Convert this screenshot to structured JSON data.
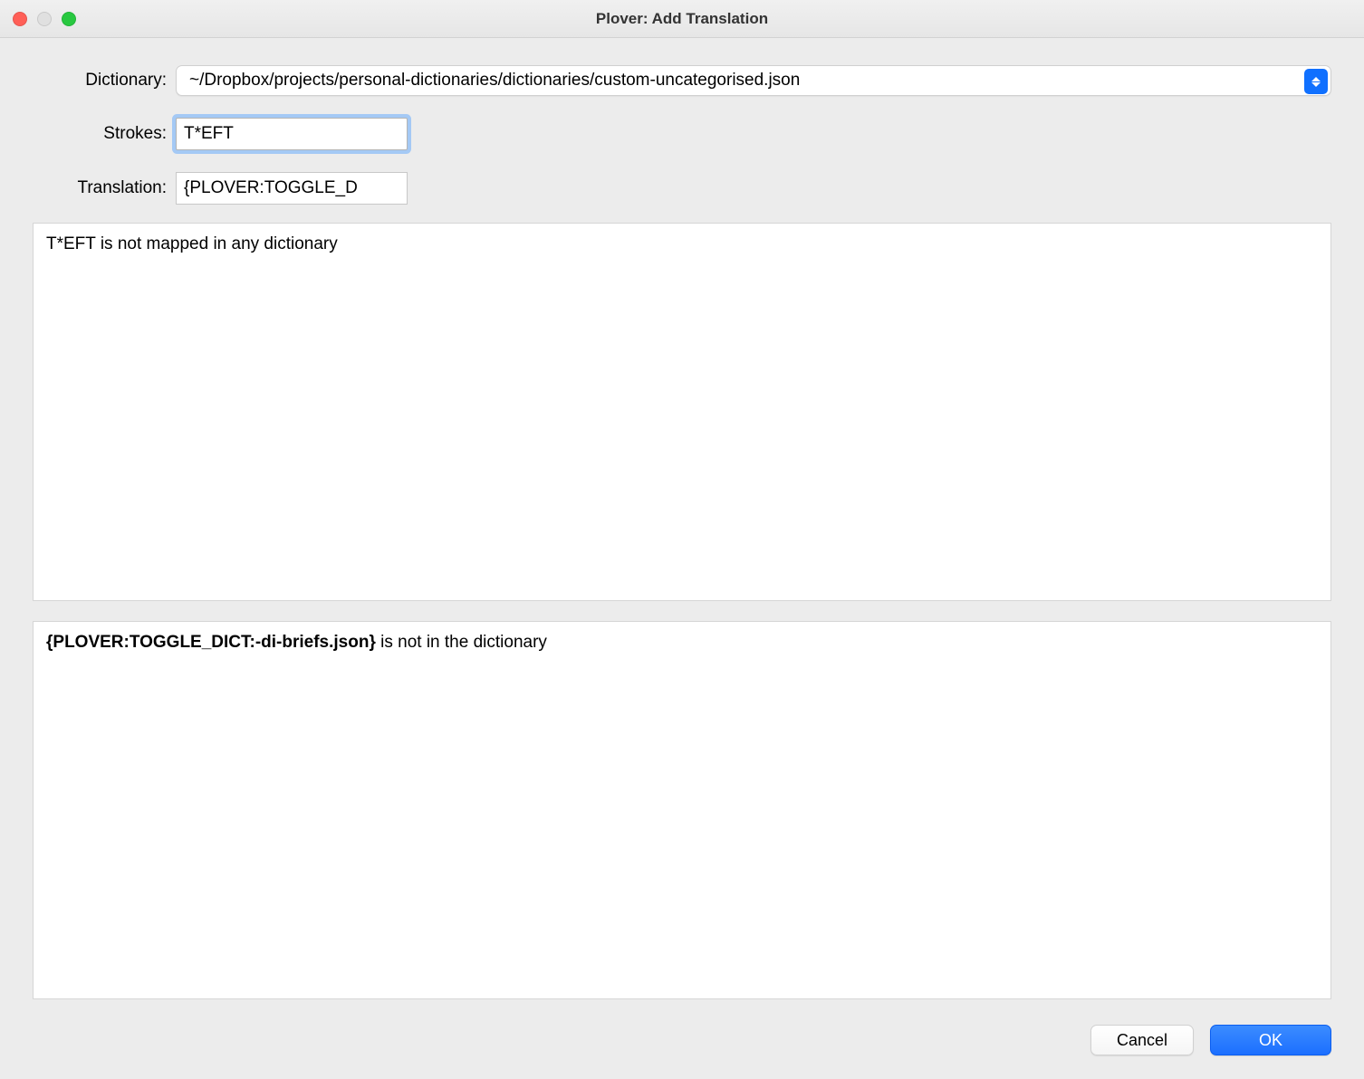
{
  "window": {
    "title": "Plover: Add Translation"
  },
  "form": {
    "dictionary_label": "Dictionary:",
    "dictionary_value": "~/Dropbox/projects/personal-dictionaries/dictionaries/custom-uncategorised.json",
    "strokes_label": "Strokes:",
    "strokes_value": "T*EFT",
    "translation_label": "Translation:",
    "translation_value": "{PLOVER:TOGGLE_D"
  },
  "info": {
    "strokes_status": "T*EFT is not mapped in any dictionary",
    "translation_bold": "{PLOVER:TOGGLE_DICT:-di-briefs.json}",
    "translation_suffix": " is not in the dictionary"
  },
  "buttons": {
    "cancel": "Cancel",
    "ok": "OK"
  }
}
